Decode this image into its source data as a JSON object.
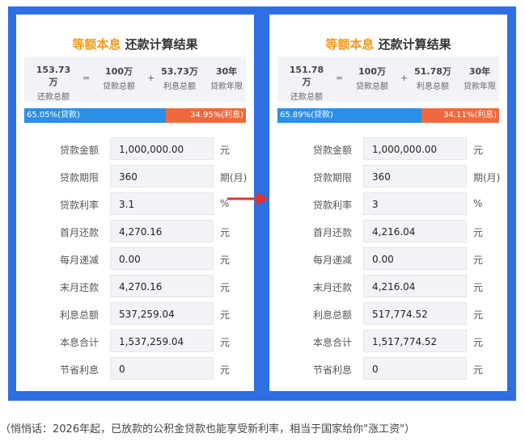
{
  "panels": [
    {
      "title_highlight": "等额本息",
      "title_rest": "还款计算结果",
      "summary": {
        "total_repay": "153.73万",
        "total_repay_label": "还款总额",
        "eq": "=",
        "loan_total": "100万",
        "loan_total_label": "贷款总额",
        "plus": "+",
        "interest_total": "53.73万",
        "interest_total_label": "利息总额",
        "years": "30年",
        "years_label": "贷款年限"
      },
      "bar": {
        "principal_text": "65.05%(贷款)",
        "interest_text": "34.95%(利息)",
        "principal_fraction": 0.6505
      },
      "rows": [
        {
          "label": "贷款金额",
          "value": "1,000,000.00",
          "unit": "元"
        },
        {
          "label": "贷款期限",
          "value": "360",
          "unit": "期(月)"
        },
        {
          "label": "贷款利率",
          "value": "3.1",
          "unit": "%"
        },
        {
          "label": "首月还款",
          "value": "4,270.16",
          "unit": "元"
        },
        {
          "label": "每月递减",
          "value": "0.00",
          "unit": "元"
        },
        {
          "label": "末月还款",
          "value": "4,270.16",
          "unit": "元"
        },
        {
          "label": "利息总额",
          "value": "537,259.04",
          "unit": "元"
        },
        {
          "label": "本息合计",
          "value": "1,537,259.04",
          "unit": "元"
        },
        {
          "label": "节省利息",
          "value": "0",
          "unit": "元"
        }
      ]
    },
    {
      "title_highlight": "等额本息",
      "title_rest": "还款计算结果",
      "summary": {
        "total_repay": "151.78万",
        "total_repay_label": "还款总额",
        "eq": "=",
        "loan_total": "100万",
        "loan_total_label": "贷款总额",
        "plus": "+",
        "interest_total": "51.78万",
        "interest_total_label": "利息总额",
        "years": "30年",
        "years_label": "贷款年限"
      },
      "bar": {
        "principal_text": "65.89%(贷款)",
        "interest_text": "34.11%(利息)",
        "principal_fraction": 0.6589
      },
      "rows": [
        {
          "label": "贷款金额",
          "value": "1,000,000.00",
          "unit": "元"
        },
        {
          "label": "贷款期限",
          "value": "360",
          "unit": "期(月)"
        },
        {
          "label": "贷款利率",
          "value": "3",
          "unit": "%"
        },
        {
          "label": "首月还款",
          "value": "4,216.04",
          "unit": "元"
        },
        {
          "label": "每月递减",
          "value": "0.00",
          "unit": "元"
        },
        {
          "label": "末月还款",
          "value": "4,216.04",
          "unit": "元"
        },
        {
          "label": "利息总额",
          "value": "517,774.52",
          "unit": "元"
        },
        {
          "label": "本息合计",
          "value": "1,517,774.52",
          "unit": "元"
        },
        {
          "label": "节省利息",
          "value": "0",
          "unit": "元"
        }
      ]
    }
  ],
  "colors": {
    "frame": "#2f6fe4",
    "principal": "#2b8fe7",
    "interest": "#f0683d",
    "title_highlight": "#f39a1e",
    "arrow": "#e5322b"
  },
  "caption": "（悄悄话：2026年起，已放款的公积金贷款也能享受新利率，相当于国家给你\"涨工资\"）"
}
